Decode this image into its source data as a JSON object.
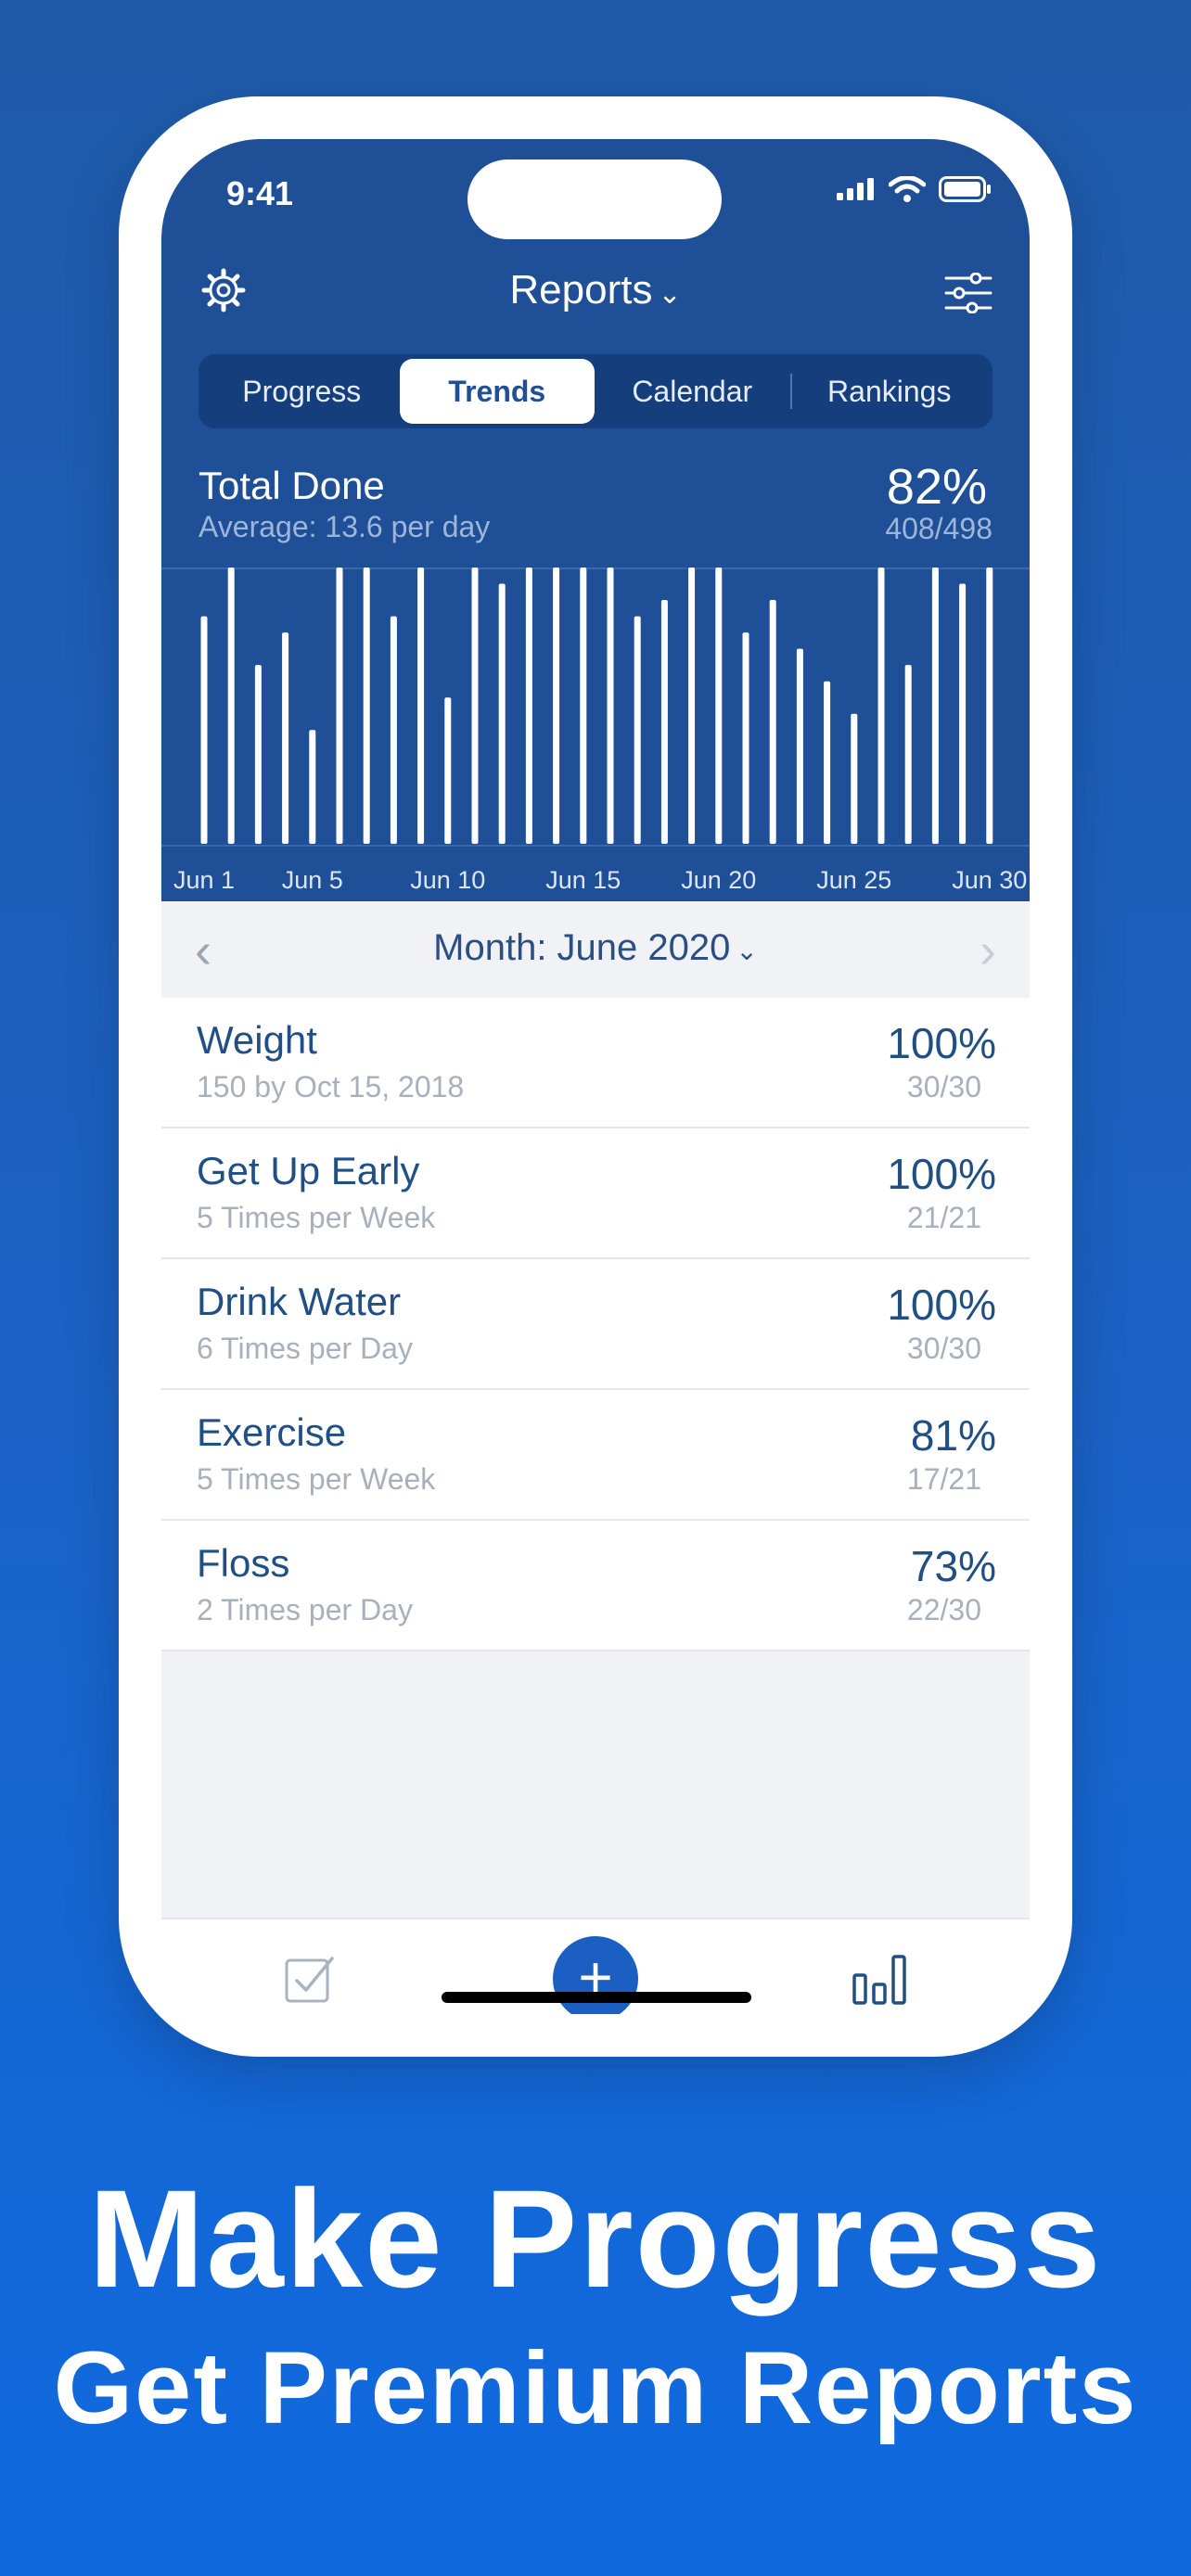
{
  "status": {
    "time": "9:41"
  },
  "nav": {
    "title": "Reports",
    "title_chevron": "⌄"
  },
  "segments": [
    "Progress",
    "Trends",
    "Calendar",
    "Rankings"
  ],
  "summary": {
    "title": "Total Done",
    "average": "Average: 13.6 per day",
    "percent": "82%",
    "fraction": "408/498"
  },
  "month_selector": {
    "label": "Month: June 2020",
    "chevron": "⌄",
    "prev": "‹",
    "next": "›"
  },
  "habits": [
    {
      "name": "Weight",
      "detail": "150 by Oct 15, 2018",
      "percent": "100%",
      "fraction": "30/30"
    },
    {
      "name": "Get Up Early",
      "detail": "5 Times per Week",
      "percent": "100%",
      "fraction": "21/21"
    },
    {
      "name": "Drink Water",
      "detail": "6 Times per Day",
      "percent": "100%",
      "fraction": "30/30"
    },
    {
      "name": "Exercise",
      "detail": "5 Times per Week",
      "percent": "81%",
      "fraction": "17/21"
    },
    {
      "name": "Floss",
      "detail": "2 Times per Day",
      "percent": "73%",
      "fraction": "22/30"
    }
  ],
  "tabbar": {
    "add_symbol": "+"
  },
  "marketing": {
    "headline": "Make Progress",
    "subline": "Get Premium Reports"
  },
  "colors": {
    "panel": "#1f4f96",
    "accent": "#1c5fc2",
    "bar": "#ffffff"
  },
  "chart_data": {
    "type": "bar",
    "title": "",
    "categories": [
      "Jun 1",
      "Jun 2",
      "Jun 3",
      "Jun 4",
      "Jun 5",
      "Jun 6",
      "Jun 7",
      "Jun 8",
      "Jun 9",
      "Jun 10",
      "Jun 11",
      "Jun 12",
      "Jun 13",
      "Jun 14",
      "Jun 15",
      "Jun 16",
      "Jun 17",
      "Jun 18",
      "Jun 19",
      "Jun 20",
      "Jun 21",
      "Jun 22",
      "Jun 23",
      "Jun 24",
      "Jun 25",
      "Jun 26",
      "Jun 27",
      "Jun 28",
      "Jun 29",
      "Jun 30"
    ],
    "tick_labels": [
      "Jun 1",
      "Jun 5",
      "Jun 10",
      "Jun 15",
      "Jun 20",
      "Jun 25",
      "Jun 30"
    ],
    "values": [
      14,
      17,
      11,
      13,
      7,
      17,
      17,
      14,
      17,
      9,
      17,
      16,
      17,
      17,
      17,
      17,
      14,
      15,
      17,
      17,
      13,
      15,
      12,
      10,
      8,
      17,
      11,
      17,
      16,
      17
    ],
    "ylim": [
      0,
      17
    ],
    "grid": false
  }
}
